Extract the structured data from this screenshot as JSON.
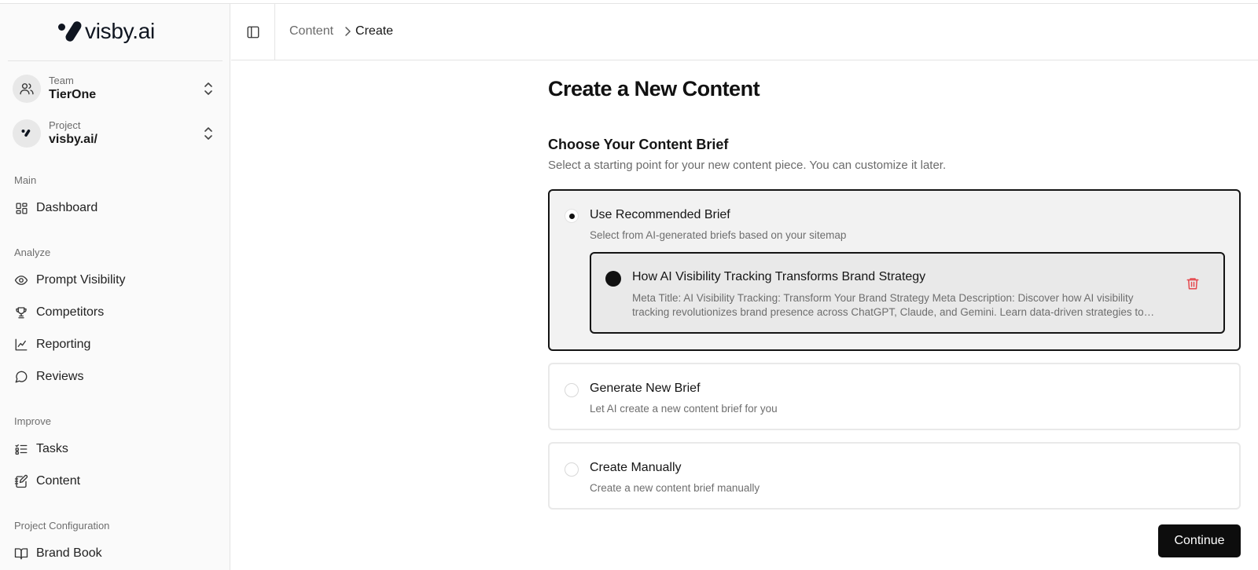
{
  "brand": {
    "name": "visby.ai"
  },
  "sidebar": {
    "team": {
      "label": "Team",
      "value": "TierOne"
    },
    "project": {
      "label": "Project",
      "value": "visby.ai/"
    },
    "sections": {
      "main": "Main",
      "analyze": "Analyze",
      "improve": "Improve",
      "config": "Project Configuration"
    },
    "items": {
      "dashboard": "Dashboard",
      "prompt_visibility": "Prompt Visibility",
      "competitors": "Competitors",
      "reporting": "Reporting",
      "reviews": "Reviews",
      "tasks": "Tasks",
      "content": "Content",
      "brand_book": "Brand Book"
    }
  },
  "breadcrumb": {
    "parent": "Content",
    "current": "Create"
  },
  "page": {
    "title": "Create a New Content",
    "section_title": "Choose Your Content Brief",
    "section_desc": "Select a starting point for your new content piece. You can customize it later."
  },
  "options": [
    {
      "title": "Use Recommended Brief",
      "desc": "Select from AI-generated briefs based on your sitemap",
      "selected": true,
      "brief": {
        "title": "How AI Visibility Tracking Transforms Brand Strategy",
        "meta": "Meta Title: AI Visibility Tracking: Transform Your Brand Strategy Meta Description: Discover how AI visibility tracking revolutionizes brand presence across ChatGPT, Claude, and Gemini. Learn data-driven strategies to optimize your brand visibility in AI responses."
      }
    },
    {
      "title": "Generate New Brief",
      "desc": "Let AI create a new content brief for you",
      "selected": false
    },
    {
      "title": "Create Manually",
      "desc": "Create a new content brief manually",
      "selected": false
    }
  ],
  "actions": {
    "continue": "Continue"
  },
  "colors": {
    "primary": "#0d0d0d",
    "danger": "#e5484d",
    "muted": "#6e6e6e",
    "sidebar_bg": "#fafafa"
  }
}
